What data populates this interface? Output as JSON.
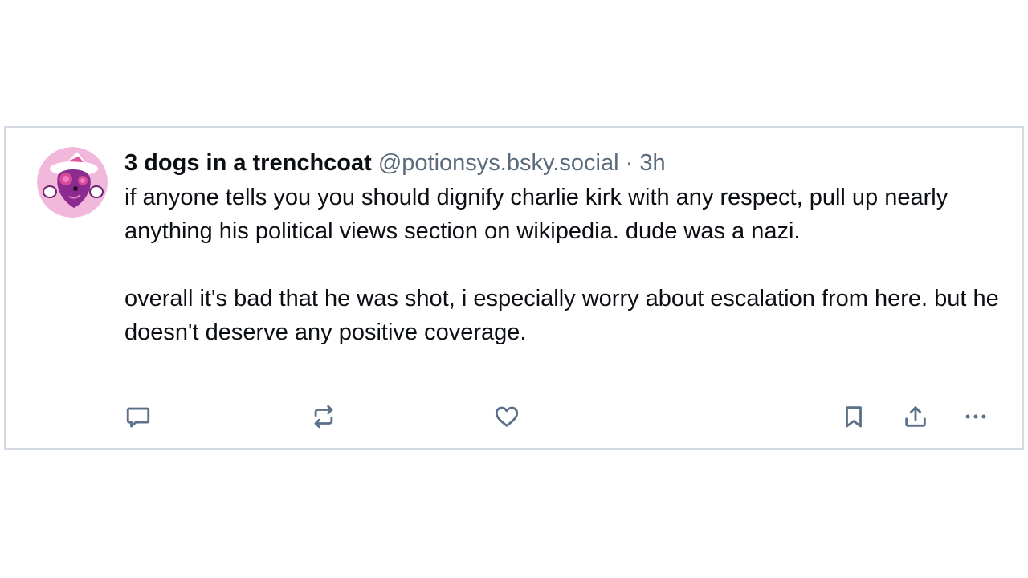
{
  "post": {
    "author": {
      "display_name": "3 dogs in a trenchcoat",
      "handle": "@potionsys.bsky.social",
      "avatar_icon": "wizard-character-avatar"
    },
    "separator": "·",
    "timestamp": "3h",
    "paragraphs": [
      "if anyone tells you you should dignify charlie kirk with any respect, pull up nearly anything his political views section on wikipedia. dude was a nazi.",
      "overall it's bad that he was shot, i especially worry about escalation from here. but he doesn't deserve any positive coverage."
    ]
  },
  "actions": {
    "reply_icon": "speech-bubble-icon",
    "repost_icon": "repost-arrows-icon",
    "like_icon": "heart-icon",
    "bookmark_icon": "bookmark-icon",
    "share_icon": "share-upload-icon",
    "more_icon": "more-dots-icon"
  },
  "colors": {
    "text": "#0b0f14",
    "muted": "#5b6b7c",
    "icon": "#5b7089",
    "border": "#d4dbe2",
    "avatar_background": "#f2b8dc"
  }
}
